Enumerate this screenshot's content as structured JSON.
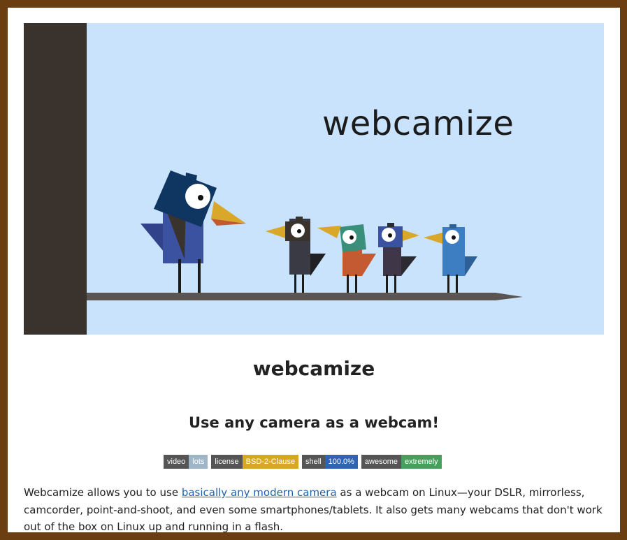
{
  "hero": {
    "title": "webcamize"
  },
  "page_title": "webcamize",
  "tagline": "Use any camera as a webcam!",
  "badges": [
    {
      "label": "video",
      "value": "lots",
      "color": "#9fb6c8"
    },
    {
      "label": "license",
      "value": "BSD-2-Clause",
      "color": "#d8a823"
    },
    {
      "label": "shell",
      "value": "100.0%",
      "color": "#2f63b4"
    },
    {
      "label": "awesome",
      "value": "extremely",
      "color": "#46a05c"
    }
  ],
  "description": {
    "before": "Webcamize allows you to use ",
    "link": "basically any modern camera",
    "after": " as a webcam on Linux—your DSLR, mirrorless, camcorder, point-and-shoot, and even some smartphones/tablets. It also gets many webcams that don't work out of the box on Linux up and running in a flash."
  },
  "colors": {
    "page_border": "#6b3e12",
    "hero_background": "#c9e3fd",
    "post": "#3a322c",
    "branch": "#5a5452",
    "link": "#1f5fa8"
  }
}
